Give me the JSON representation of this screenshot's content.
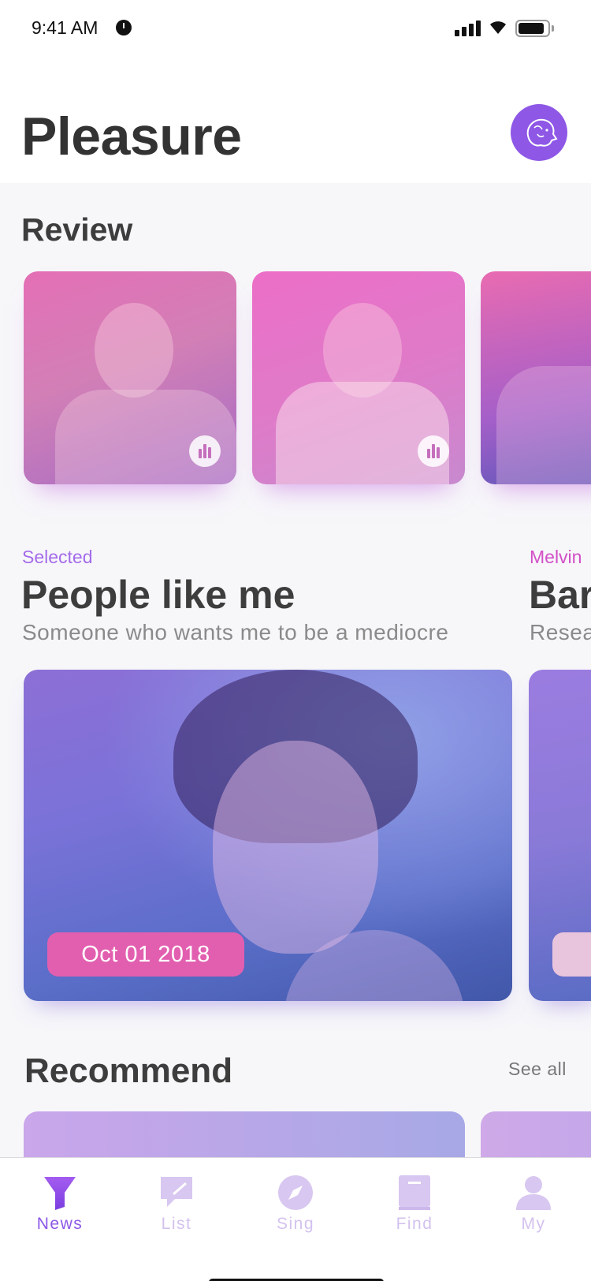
{
  "status_bar": {
    "time": "9:41 AM"
  },
  "header": {
    "title": "Pleasure"
  },
  "review": {
    "title": "Review"
  },
  "featured": [
    {
      "tag": "Selected",
      "tag_color": "#a56bea",
      "title": "People like me",
      "subtitle": "Someone who wants me to be a mediocre",
      "date": "Oct 01 2018"
    },
    {
      "tag": "Melvin",
      "tag_color": "#d24fc7",
      "title": "Bar",
      "subtitle": "Resea"
    }
  ],
  "recommend": {
    "title": "Recommend",
    "see_all": "See all"
  },
  "tabs": [
    {
      "label": "News",
      "icon": "funnel-icon",
      "active": true
    },
    {
      "label": "List",
      "icon": "chat-icon",
      "active": false
    },
    {
      "label": "Sing",
      "icon": "compass-icon",
      "active": false
    },
    {
      "label": "Find",
      "icon": "book-icon",
      "active": false
    },
    {
      "label": "My",
      "icon": "person-icon",
      "active": false
    }
  ],
  "colors": {
    "accent": "#8d57e7",
    "pink": "#e25fb0",
    "inactive_tab": "#d3c2ee"
  }
}
